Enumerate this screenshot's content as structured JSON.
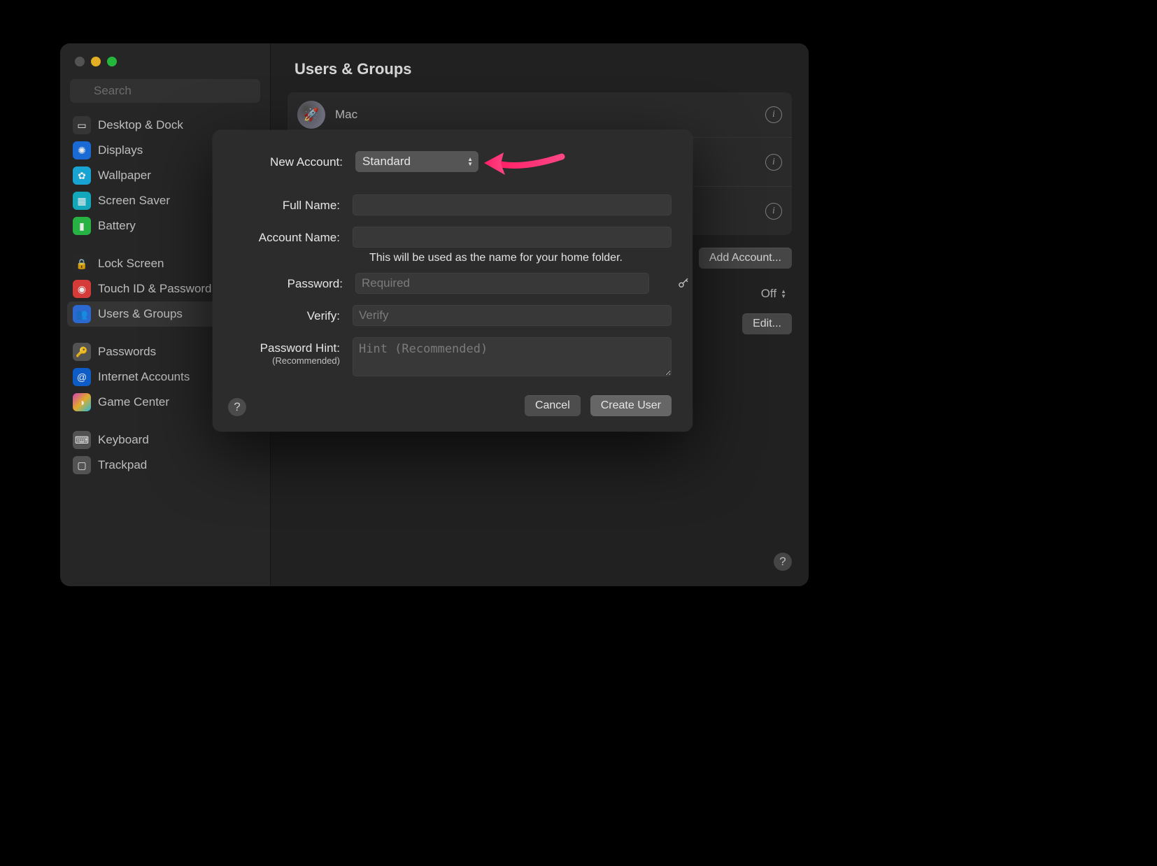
{
  "window": {
    "title": "Users & Groups"
  },
  "search": {
    "placeholder": "Search"
  },
  "sidebar": {
    "groups": [
      [
        {
          "label": "Desktop & Dock",
          "icon": "desktop"
        },
        {
          "label": "Displays",
          "icon": "displays"
        },
        {
          "label": "Wallpaper",
          "icon": "wallpaper"
        },
        {
          "label": "Screen Saver",
          "icon": "screensvr"
        },
        {
          "label": "Battery",
          "icon": "battery"
        }
      ],
      [
        {
          "label": "Lock Screen",
          "icon": "lock"
        },
        {
          "label": "Touch ID & Password",
          "icon": "touchid"
        },
        {
          "label": "Users & Groups",
          "icon": "users",
          "selected": true
        }
      ],
      [
        {
          "label": "Passwords",
          "icon": "passwords"
        },
        {
          "label": "Internet Accounts",
          "icon": "internet"
        },
        {
          "label": "Game Center",
          "icon": "gamectr"
        }
      ],
      [
        {
          "label": "Keyboard",
          "icon": "keyboard"
        },
        {
          "label": "Trackpad",
          "icon": "trackpad"
        }
      ]
    ]
  },
  "users": {
    "accounts": [
      {
        "name": "Mac"
      }
    ],
    "add_account_label": "Add Account...",
    "auto_login_value": "Off",
    "edit_label": "Edit..."
  },
  "sheet": {
    "labels": {
      "new_account": "New Account:",
      "full_name": "Full Name:",
      "account_name": "Account Name:",
      "account_name_hint": "This will be used as the name for your home folder.",
      "password": "Password:",
      "verify": "Verify:",
      "hint": "Password Hint:",
      "hint_sub": "(Recommended)"
    },
    "new_account_type": "Standard",
    "full_name_value": "",
    "account_name_value": "",
    "password_placeholder": "Required",
    "verify_placeholder": "Verify",
    "hint_placeholder": "Hint (Recommended)",
    "cancel_label": "Cancel",
    "create_label": "Create User"
  }
}
